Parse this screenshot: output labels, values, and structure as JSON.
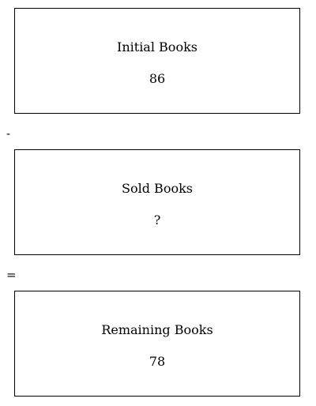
{
  "boxes": [
    {
      "label": "Initial Books",
      "value": "86"
    },
    {
      "label": "Sold Books",
      "value": "?"
    },
    {
      "label": "Remaining Books",
      "value": "78"
    }
  ],
  "operators": {
    "minus": "-",
    "equals": "="
  }
}
